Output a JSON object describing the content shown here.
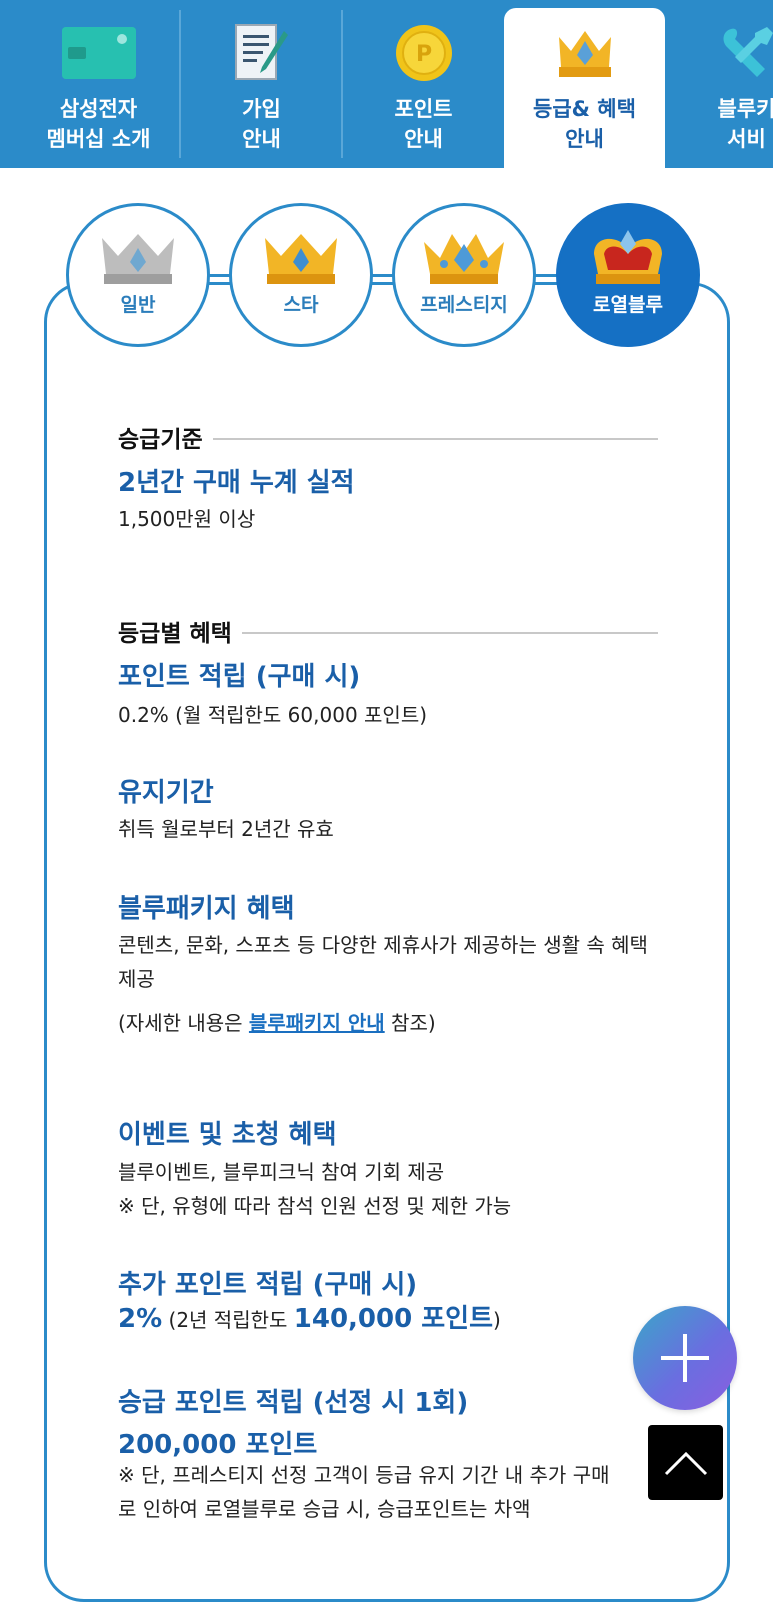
{
  "tabs": [
    {
      "label": "삼성전자\n멤버십 소개",
      "icon": "card-icon",
      "active": false
    },
    {
      "label": "가입\n안내",
      "icon": "document-pen-icon",
      "active": false
    },
    {
      "label": "포인트\n안내",
      "icon": "point-coin-icon",
      "active": false
    },
    {
      "label": "등급& 혜택\n안내",
      "icon": "crown-icon",
      "active": true
    },
    {
      "label": "블루키\n서비",
      "icon": "wrench-icon",
      "active": false
    }
  ],
  "grades": [
    {
      "label": "일반",
      "icon": "silver-crown-icon",
      "active": false
    },
    {
      "label": "스타",
      "icon": "gold-crown-icon",
      "active": false
    },
    {
      "label": "프레스티지",
      "icon": "prestige-crown-icon",
      "active": false
    },
    {
      "label": "로열블루",
      "icon": "royal-crown-icon",
      "active": true
    }
  ],
  "criteria": {
    "heading": "승급기준",
    "title": "2년간 구매 누계 실적",
    "text": "1,500만원 이상"
  },
  "benefits": {
    "heading": "등급별 혜택",
    "points": {
      "title": "포인트 적립 (구매 시)",
      "text": "0.2% (월 적립한도 60,000 포인트)"
    },
    "period": {
      "title": "유지기간",
      "text": "취득 월로부터 2년간 유효"
    },
    "bluepackage": {
      "title": "블루패키지 혜택",
      "text": "콘텐츠, 문화, 스포츠 등 다양한 제휴사가 제공하는 생활 속 혜택 제공",
      "ref_prefix": "(자세한 내용은 ",
      "ref_link": "블루패키지 안내",
      "ref_suffix": " 참조)"
    },
    "event": {
      "title": "이벤트 및 초청 혜택",
      "line1": "블루이벤트, 블루피크닉 참여 기회 제공",
      "line2": "※ 단, 유형에 따라 참석 인원 선정 및 제한 가능"
    },
    "extra": {
      "title": "추가 포인트 적립 (구매 시)",
      "rate": "2%",
      "paren_open": " (2년 적립한도 ",
      "limit": "140,000 포인트",
      "paren_close": ")"
    },
    "promo": {
      "title": "승급 포인트 적립 (선정 시 1회)",
      "amount": "200,000 포인트",
      "note": "※ 단, 프레스티지 선정 고객이 등급 유지 기간 내 추가 구매로 인하여 로열블루로 승급 시, 승급포인트는 차액"
    }
  },
  "colors": {
    "primary": "#2b8bc9",
    "accent_text": "#1a5fa8",
    "active_grade": "#1570c4"
  }
}
